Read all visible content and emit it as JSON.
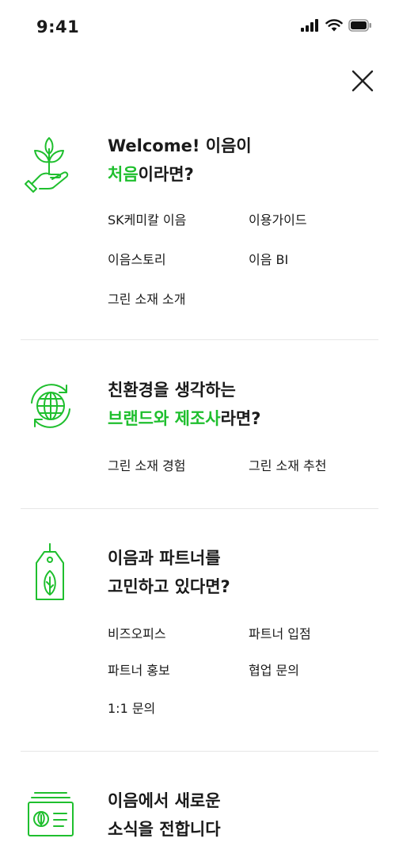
{
  "status_bar": {
    "time": "9:41"
  },
  "close": {
    "label": "close"
  },
  "sections": [
    {
      "icon": "hand-sprout-icon",
      "title_line1": "Welcome! 이음이",
      "title_line2_highlight": "처음",
      "title_line2_rest": "이라면?",
      "links": [
        "SK케미칼 이음",
        "이용가이드",
        "이음스토리",
        "이음 BI",
        "그린 소재 소개"
      ]
    },
    {
      "icon": "eco-globe-icon",
      "title_line1": "친환경을 생각하는",
      "title_line2_highlight": "브랜드와 제조사",
      "title_line2_rest": "라면?",
      "links": [
        "그린 소재 경험",
        "그린 소재 추천"
      ]
    },
    {
      "icon": "leaf-tag-icon",
      "title_line1": "이음과 파트너를",
      "title_line2": "고민하고 있다면?",
      "links": [
        "비즈오피스",
        "파트너 입점",
        "파트너 홍보",
        "협업 문의",
        "1:1 문의"
      ]
    },
    {
      "icon": "newsletter-icon",
      "title_line1": "이음에서 새로운",
      "title_line2": "소식을 전합니다",
      "links": []
    }
  ],
  "colors": {
    "accent": "#1fbf2e",
    "text": "#1a1a1a",
    "divider": "#e6e6e6"
  }
}
